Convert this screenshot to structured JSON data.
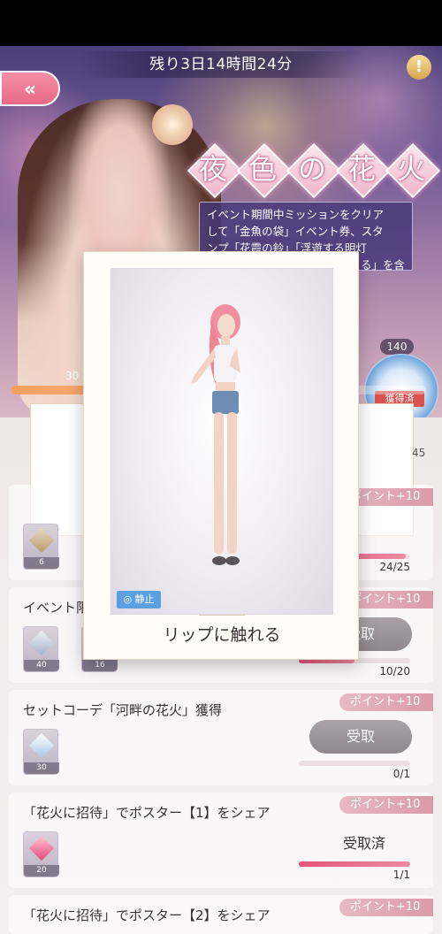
{
  "header": {
    "timer_text": "残り3日14時間24分",
    "back_icon": "double-chevron-left-icon",
    "info_icon": "exclamation-icon"
  },
  "event": {
    "title_chars": [
      "夜",
      "色",
      "の",
      "花",
      "火"
    ],
    "description_lines": [
      "イベント期間中ミッションをクリア",
      "して「金魚の袋」イベント券、スタ",
      "ンプ「花霞の鈴」「浮遊する明灯",
      "る」を含"
    ]
  },
  "progress": {
    "points_left": "30",
    "points_right": "45",
    "top_counter": "140",
    "fraction": 0.66,
    "reward_badge": "獲得済"
  },
  "overlay": {
    "caption": "リップに触れる",
    "static_label": "静止"
  },
  "tasks": [
    {
      "title": "",
      "points": "ポイント+10",
      "items": [
        {
          "count": "6",
          "icon": "ornament-icon"
        }
      ],
      "progress_text": "24/25",
      "progress": 0.96,
      "action": ""
    },
    {
      "title": "イベント限",
      "points": "ポイント+10",
      "items": [
        {
          "count": "40",
          "icon": "key-icon"
        },
        {
          "count": "16",
          "icon": "item-icon"
        }
      ],
      "progress_text": "10/20",
      "progress": 0.5,
      "action": "受取"
    },
    {
      "title": "セットコーデ「河畔の花火」獲得",
      "points": "ポイント+10",
      "items": [
        {
          "count": "30",
          "icon": "crystal-icon"
        }
      ],
      "progress_text": "0/1",
      "progress": 0,
      "action": "受取"
    },
    {
      "title": "「花火に招待」でポスター【1】をシェア",
      "points": "ポイント+10",
      "items": [
        {
          "count": "20",
          "icon": "pink-gem-icon"
        }
      ],
      "progress_text": "1/1",
      "progress": 1,
      "action": "受取済"
    },
    {
      "title": "「花火に招待」でポスター【2】をシェア",
      "points": "ポイント+10"
    }
  ]
}
